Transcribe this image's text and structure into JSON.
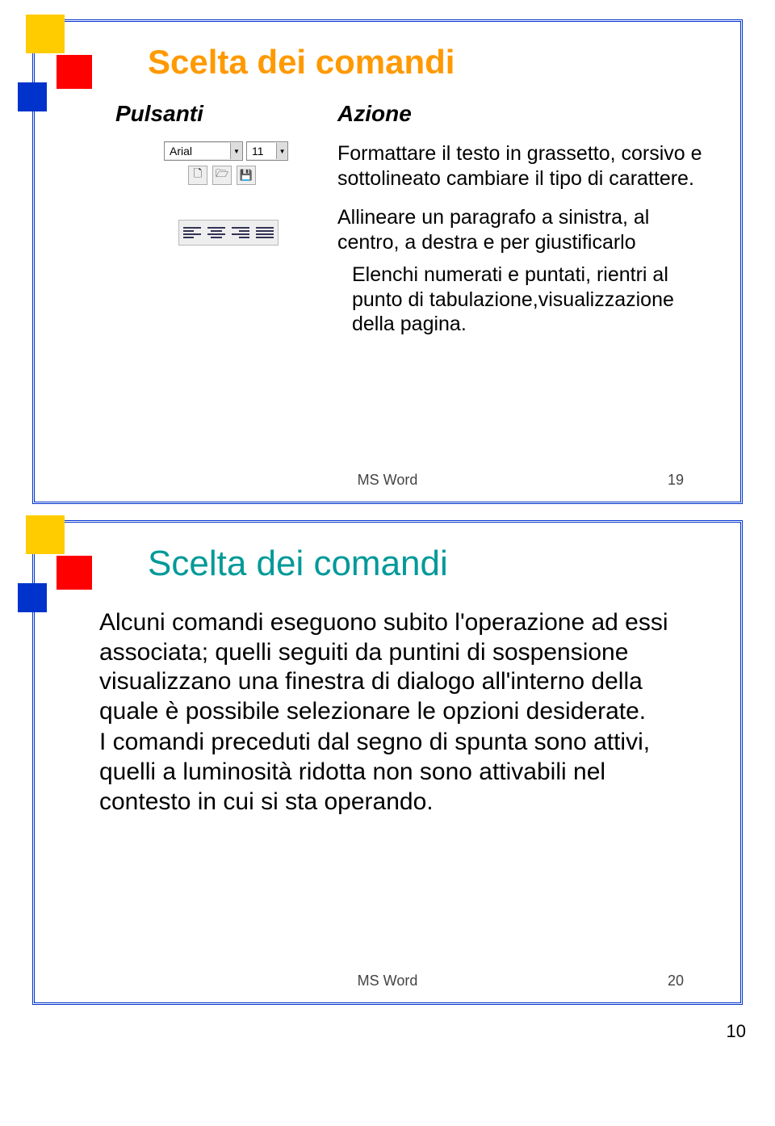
{
  "slide1": {
    "title": "Scelta dei comandi",
    "col1": "Pulsanti",
    "col2": "Azione",
    "fontName": "Arial",
    "fontSize": "11",
    "desc_format": "Formattare il testo in grassetto, corsivo e sottolineato cambiare il tipo di carattere.",
    "desc_align": "Allineare un paragrafo a sinistra, al centro, a destra e per giustificarlo",
    "desc_list": "Elenchi numerati e puntati, rientri al punto di tabulazione,visualizzazione della pagina.",
    "footer": "MS Word",
    "pageNum": "19"
  },
  "slide2": {
    "title": "Scelta dei comandi",
    "body1": "Alcuni comandi eseguono subito l'operazione ad essi associata; quelli seguiti da puntini di sospensione visualizzano una finestra di dialogo all'interno della quale è possibile selezionare le opzioni desiderate.",
    "body2": "I comandi preceduti dal segno di spunta sono attivi, quelli a luminosità ridotta non sono attivabili nel contesto in cui si sta operando.",
    "footer": "MS Word",
    "pageNum": "20"
  },
  "docPage": "10"
}
